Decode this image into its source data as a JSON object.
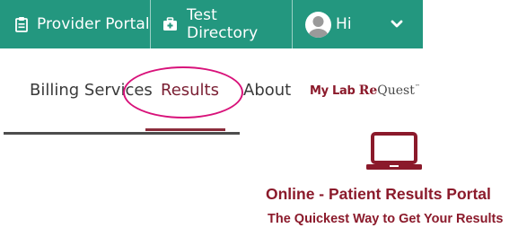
{
  "topbar": {
    "provider_portal": {
      "label": "Provider Portal",
      "icon": "clipboard-icon"
    },
    "test_directory": {
      "label": "Test Directory",
      "icon": "medical-kit-icon"
    },
    "user_menu": {
      "greeting": "Hi",
      "avatar_icon": "user-avatar-icon",
      "chevron_icon": "chevron-down-icon"
    }
  },
  "nav": {
    "billing": "Billing Services",
    "results": "Results",
    "about": "About"
  },
  "brand": {
    "part1": "My Lab ",
    "part2": "Re",
    "part3": "Quest",
    "trademark": "™"
  },
  "content": {
    "icon": "laptop-icon",
    "title": "Online - Patient Results Portal",
    "subtitle": "The Quickest Way to Get Your Results"
  },
  "colors": {
    "teal": "#23977f",
    "maroon": "#8b1a2b",
    "highlight": "#d8127a"
  }
}
